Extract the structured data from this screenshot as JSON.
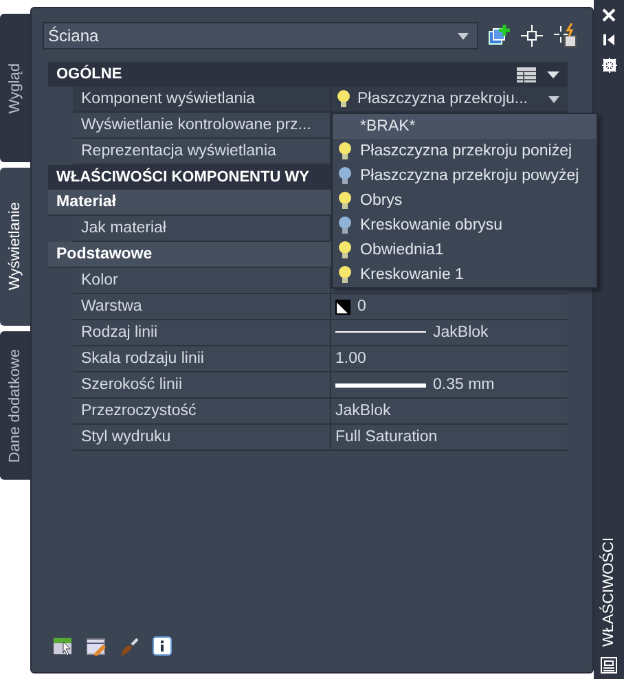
{
  "object_type": {
    "value": "Ściana"
  },
  "side_tabs": [
    {
      "label": "Wygląd",
      "selected": false
    },
    {
      "label": "Wyświetlanie",
      "selected": true
    },
    {
      "label": "Dane dodatkowe",
      "selected": false
    }
  ],
  "sections": [
    {
      "title": "OGÓLNE",
      "rows": [
        {
          "label": "Komponent wyświetlania",
          "value": "Płaszczyzna  przekroju...",
          "kind": "dropdown",
          "selected": true
        },
        {
          "label": "Wyświetlanie  kontrolowane  prz...",
          "kind": "text",
          "selected": false
        },
        {
          "label": "Reprezentacja wyświetlania",
          "kind": "text",
          "selected": false
        }
      ]
    },
    {
      "title": "WŁAŚCIWOŚCI KOMPONENTU WY",
      "subsections": [
        {
          "title": "Materiał",
          "rows": [
            {
              "label": "Jak materiał",
              "kind": "text",
              "selected": false
            }
          ]
        },
        {
          "title": "Podstawowe",
          "rows": [
            {
              "label": "Kolor",
              "kind": "text",
              "selected": false
            },
            {
              "label": "Warstwa",
              "value": "0",
              "kind": "layer",
              "selected": false
            },
            {
              "label": "Rodzaj linii",
              "value": "JakBlok",
              "kind": "linetype",
              "selected": false
            },
            {
              "label": "Skala rodzaju linii",
              "value": "1.00",
              "kind": "text",
              "selected": false
            },
            {
              "label": "Szerokość linii",
              "value": "0.35 mm",
              "kind": "lineweight",
              "selected": false
            },
            {
              "label": "Przezroczystość",
              "value": "JakBlok",
              "kind": "text",
              "selected": false
            },
            {
              "label": "Styl wydruku",
              "value": "Full Saturation",
              "kind": "text",
              "selected": false
            }
          ]
        }
      ]
    }
  ],
  "dropdown_list": [
    {
      "label": "*BRAK*",
      "kind": "none",
      "selected": true
    },
    {
      "label": "Płaszczyzna przekroju poniżej",
      "kind": "on",
      "selected": false
    },
    {
      "label": "Płaszczyzna przekroju powyżej",
      "kind": "off",
      "selected": false
    },
    {
      "label": "Obrys",
      "kind": "on",
      "selected": false
    },
    {
      "label": "Kreskowanie obrysu",
      "kind": "off",
      "selected": false
    },
    {
      "label": "Obwiednia1",
      "kind": "on",
      "selected": false
    },
    {
      "label": "Kreskowanie 1",
      "kind": "on",
      "selected": false
    }
  ],
  "palette_title": "WŁAŚCIWOŚCI"
}
